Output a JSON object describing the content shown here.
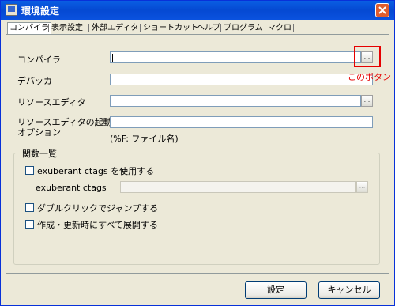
{
  "window": {
    "title": "環境設定"
  },
  "tabs": [
    {
      "label": "コンパイラ",
      "active": true
    },
    {
      "label": "表示設定"
    },
    {
      "label": "外部エディタ"
    },
    {
      "label": "ショートカット"
    },
    {
      "label": "ヘルプ"
    },
    {
      "label": "プログラム"
    },
    {
      "label": "マクロ"
    }
  ],
  "fields": {
    "compiler": {
      "label": "コンパイラ",
      "value": "",
      "browse_label": "..."
    },
    "debugger": {
      "label": "デバッカ",
      "value": ""
    },
    "resource_editor": {
      "label": "リソースエディタ",
      "value": "",
      "browse_label": "..."
    },
    "resource_editor_options": {
      "label_line1": "リソースエディタの起動",
      "label_line2": "オプション",
      "value": "",
      "hint": "(%F: ファイル名)"
    }
  },
  "function_list": {
    "title": "関数一覧",
    "use_exuberant_ctags": {
      "label": "exuberant ctags を使用する",
      "checked": false
    },
    "exuberant_ctags_path": {
      "label": "exuberant ctags",
      "value": "",
      "browse_label": "..."
    },
    "double_click_jump": {
      "label": "ダブルクリックでジャンプする",
      "checked": false
    },
    "expand_on_create_update": {
      "label": "作成・更新時にすべて展開する",
      "checked": false
    }
  },
  "annotation": {
    "text": "このボタン",
    "color": "#e60000"
  },
  "buttons": {
    "ok_label": "設定",
    "cancel_label": "キャンセル"
  },
  "icons": {
    "close": "close-icon",
    "window": "window-icon"
  }
}
